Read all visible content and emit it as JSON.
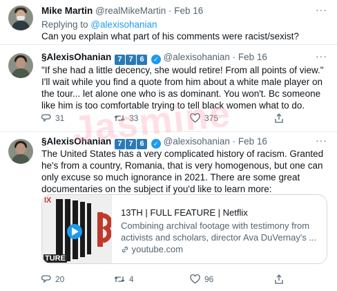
{
  "tweet1": {
    "name": "Mike Martin",
    "handle": "@realMikeMartin · Feb 16",
    "replying_prefix": "Replying to ",
    "replying_handle": "@alexisohanian",
    "text": "Can you explain what part of his comments were racist/sexist?"
  },
  "tweet2": {
    "name": "§AlexisOhanian",
    "badges": [
      "7",
      "7",
      "6"
    ],
    "handle": "@alexisohanian · Feb 16",
    "text": "\"If she had a little decency, she would retire! From all points of view.\" I'll wait while you find a quote from him about a white male player on the tour... let alone one who is as dominant. You won't. Bc someone like him is too comfortable trying to tell black women what to do.",
    "stats": {
      "replies": "31",
      "retweets": "33",
      "likes": "375"
    }
  },
  "tweet3": {
    "name": "§AlexisOhanian",
    "badges": [
      "7",
      "7",
      "6"
    ],
    "handle": "@alexisohanian · Feb 16",
    "text": "The United States has a very complicated history of racism. Granted he's from a country, Romania, that is very homogenous, but one can only excuse so much ignorance in 2021. There are some great documentaries on the subject if you'd like to learn more:",
    "card": {
      "title": "13TH | FULL FEATURE | Netflix",
      "description": "Combining archival footage with testimony from activists and scholars, director Ava DuVernay's ...",
      "domain": "youtube.com",
      "thumb_corner_text": "IX",
      "thumb_bottom_text": "TURE"
    },
    "stats": {
      "replies": "20",
      "retweets": "4",
      "likes": "96"
    }
  },
  "watermark": "Jasmine",
  "icons": {
    "more": "more-horizontal-icon",
    "reply": "reply-icon",
    "retweet": "retweet-icon",
    "like": "heart-icon",
    "share": "share-icon",
    "verified": "verified-icon",
    "link": "link-icon",
    "play": "play-icon"
  },
  "colors": {
    "accent": "#1d9bf0",
    "secondary_text": "#536471",
    "badge": "#2a7ab8"
  }
}
